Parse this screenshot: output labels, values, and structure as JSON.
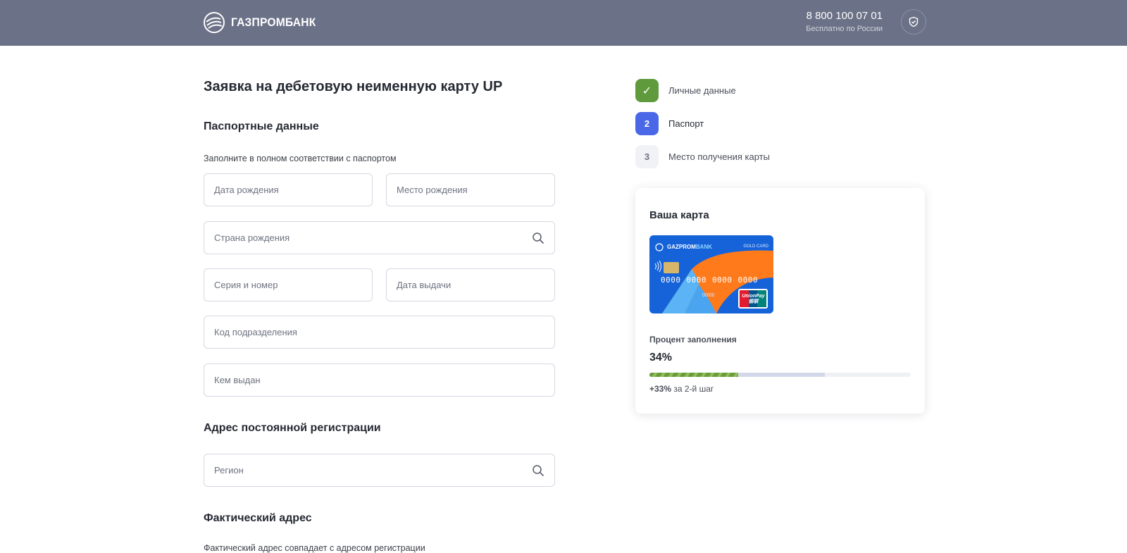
{
  "header": {
    "brand": "ГАЗПРОМБАНК",
    "phone": "8 800 100 07 01",
    "phone_note": "Бесплатно по России",
    "color": "#6b7186"
  },
  "form": {
    "title": "Заявка на дебетовую неименную карту UP",
    "passport": {
      "title": "Паспортные данные",
      "hint": "Заполните в полном соответствии с паспортом",
      "fields": {
        "birth_date": "Дата рождения",
        "birth_place": "Место рождения",
        "birth_country": "Страна рождения",
        "series_number": "Серия и номер",
        "issue_date": "Дата выдачи",
        "division_code": "Код подразделения",
        "issued_by": "Кем выдан"
      }
    },
    "registration": {
      "title": "Адрес постоянной регистрации",
      "region": "Регион"
    },
    "actual": {
      "title": "Фактический адрес",
      "hint": "Фактический адрес совпадает с адресом регистрации"
    }
  },
  "steps": [
    {
      "label": "Личные данные",
      "state": "done",
      "badge": "✓",
      "color": "#5f9a3c"
    },
    {
      "label": "Паспорт",
      "state": "current",
      "badge": "2",
      "color": "#4a67e8"
    },
    {
      "label": "Место получения карты",
      "state": "pending",
      "badge": "3",
      "color": "#f1f2f6"
    }
  ],
  "card_panel": {
    "title": "Ваша карта",
    "card": {
      "brand_a": "GAZPROM",
      "brand_b": "BANK",
      "tier": "GOLD CARD",
      "number": [
        "0000",
        "0000",
        "0000",
        "0000"
      ],
      "expiry": "00/00",
      "network_a": "UnionPay",
      "network_b": "银联"
    },
    "fill_label": "Процент заполнения",
    "fill_value": "34%",
    "fill_fraction": 0.34,
    "next_fraction": 0.67,
    "increment": "+33%",
    "increment_note": "за 2-й шаг"
  }
}
